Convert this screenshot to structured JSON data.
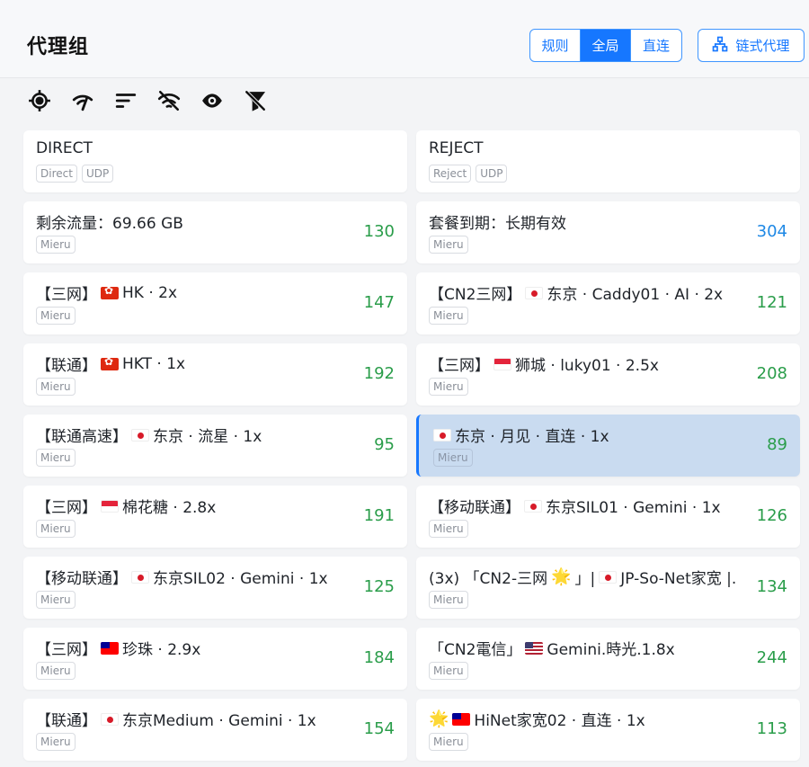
{
  "header": {
    "title": "代理组",
    "modes": [
      {
        "label": "规则",
        "active": false
      },
      {
        "label": "全局",
        "active": true
      },
      {
        "label": "直连",
        "active": false
      }
    ],
    "chain_label": "链式代理"
  },
  "toolbar": {
    "icons": [
      "locate-icon",
      "speed-test-icon",
      "sort-icon",
      "hide-unavailable-icon",
      "view-icon",
      "filter-off-icon"
    ]
  },
  "proxies": [
    {
      "name": "DIRECT",
      "tags": [
        "Direct",
        "UDP"
      ],
      "delay": ""
    },
    {
      "name": "REJECT",
      "tags": [
        "Reject",
        "UDP"
      ],
      "delay": ""
    },
    {
      "name": "剩余流量：69.66 GB",
      "tags": [
        "Mieru"
      ],
      "delay": "130"
    },
    {
      "name": "套餐到期：长期有效",
      "tags": [
        "Mieru"
      ],
      "delay": "304"
    },
    {
      "prefix": "【三网】",
      "flag": "hk",
      "name": "HK · 2x",
      "tags": [
        "Mieru"
      ],
      "delay": "147"
    },
    {
      "prefix": "【CN2三网】",
      "flag": "jp",
      "name": "东京 · Caddy01 · AI · 2x",
      "tags": [
        "Mieru"
      ],
      "delay": "121"
    },
    {
      "prefix": "【联通】",
      "flag": "hk",
      "name": "HKT · 1x",
      "tags": [
        "Mieru"
      ],
      "delay": "192"
    },
    {
      "prefix": "【三网】",
      "flag": "sg",
      "name": "狮城 · luky01 · 2.5x",
      "tags": [
        "Mieru"
      ],
      "delay": "208"
    },
    {
      "prefix": "【联通高速】",
      "flag": "jp",
      "name": "东京 · 流星 · 1x",
      "tags": [
        "Mieru"
      ],
      "delay": "95"
    },
    {
      "prefix": "",
      "flag": "jp",
      "name": "东京 · 月见 · 直连 · 1x",
      "tags": [
        "Mieru"
      ],
      "delay": "89",
      "selected": true
    },
    {
      "prefix": "【三网】",
      "flag": "sg",
      "name": "棉花糖 · 2.8x",
      "tags": [
        "Mieru"
      ],
      "delay": "191"
    },
    {
      "prefix": "【移动联通】",
      "flag": "jp",
      "name": "东京SIL01 · Gemini · 1x",
      "tags": [
        "Mieru"
      ],
      "delay": "126"
    },
    {
      "prefix": "【移动联通】",
      "flag": "jp",
      "name": "东京SIL02 · Gemini · 1x",
      "tags": [
        "Mieru"
      ],
      "delay": "125"
    },
    {
      "prefix": "(3x) 「CN2-三网",
      "star": "🌟",
      "mid": "」|",
      "flag": "jp",
      "name": "JP-So-Net家宽 |...",
      "tags": [
        "Mieru"
      ],
      "delay": "134"
    },
    {
      "prefix": "【三网】",
      "flag": "tw",
      "name": "珍珠 · 2.9x",
      "tags": [
        "Mieru"
      ],
      "delay": "184"
    },
    {
      "prefix": "「CN2電信」",
      "flag": "us",
      "name": "Gemini.時光.1.8x",
      "tags": [
        "Mieru"
      ],
      "delay": "244"
    },
    {
      "prefix": "【联通】",
      "flag": "jp",
      "name": "东京Medium · Gemini · 1x",
      "tags": [
        "Mieru"
      ],
      "delay": "154"
    },
    {
      "prefix": "",
      "star": "🌟",
      "flag": "tw",
      "name": "HiNet家宽02 · 直连 · 1x",
      "tags": [
        "Mieru"
      ],
      "delay": "113"
    }
  ],
  "colors": {
    "accent": "#1677ff",
    "delay_good": "#2a9d4a",
    "delay_info": "#1e88e5",
    "selected_bg": "#c9dbf0"
  }
}
